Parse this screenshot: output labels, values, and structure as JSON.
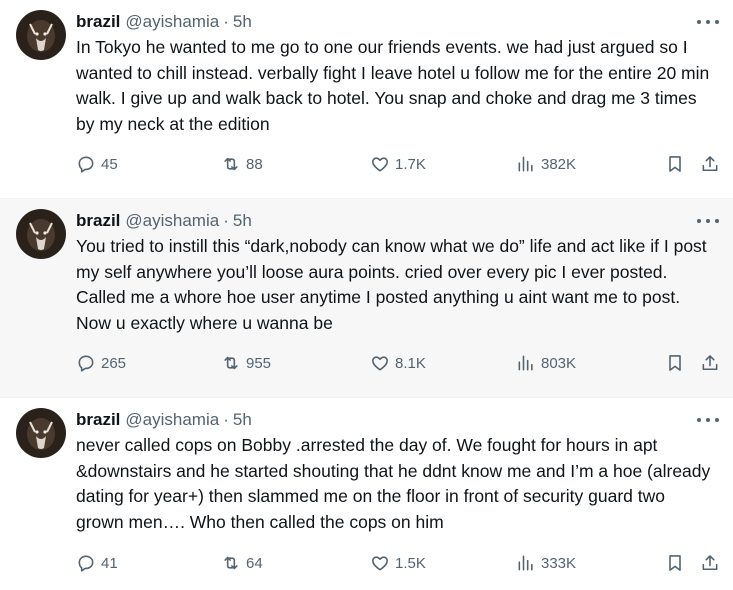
{
  "tweets": [
    {
      "name": "brazil",
      "handle": "@ayishamia",
      "separator": "·",
      "time": "5h",
      "text": "In Tokyo he wanted to me go to one our friends events. we had just argued so I wanted to chill instead. verbally fight I leave hotel u follow me for the entire 20 min walk. I give up and walk back to hotel. You snap and choke and drag me 3 times by my neck at the edition",
      "replies": "45",
      "reposts": "88",
      "likes": "1.7K",
      "views": "382K"
    },
    {
      "name": "brazil",
      "handle": "@ayishamia",
      "separator": "·",
      "time": "5h",
      "text": "You tried to instill this “dark,nobody can know what we do” life and act like if I post my self anywhere you’ll loose aura points. cried over every pic I ever posted. Called me a whore hoe user anytime I posted anything u aint want me to post. Now u exactly where u wanna be",
      "replies": "265",
      "reposts": "955",
      "likes": "8.1K",
      "views": "803K"
    },
    {
      "name": "brazil",
      "handle": "@ayishamia",
      "separator": "·",
      "time": "5h",
      "text": "never called cops on Bobby .arrested the day of. We fought for hours in apt &downstairs and he started shouting that he ddnt know me and I’m a hoe (already dating for year+) then slammed me on the floor in front of security guard two grown men…. Who then called the cops on him",
      "replies": "41",
      "reposts": "64",
      "likes": "1.5K",
      "views": "333K"
    }
  ],
  "icons": [
    "more-icon",
    "reply-icon",
    "repost-icon",
    "like-icon",
    "views-icon",
    "bookmark-icon",
    "share-icon"
  ],
  "colors": {
    "text": "#0f1419",
    "secondary": "#536471",
    "highlight_bg": "#f7f7f7",
    "divider": "#eff3f4"
  }
}
